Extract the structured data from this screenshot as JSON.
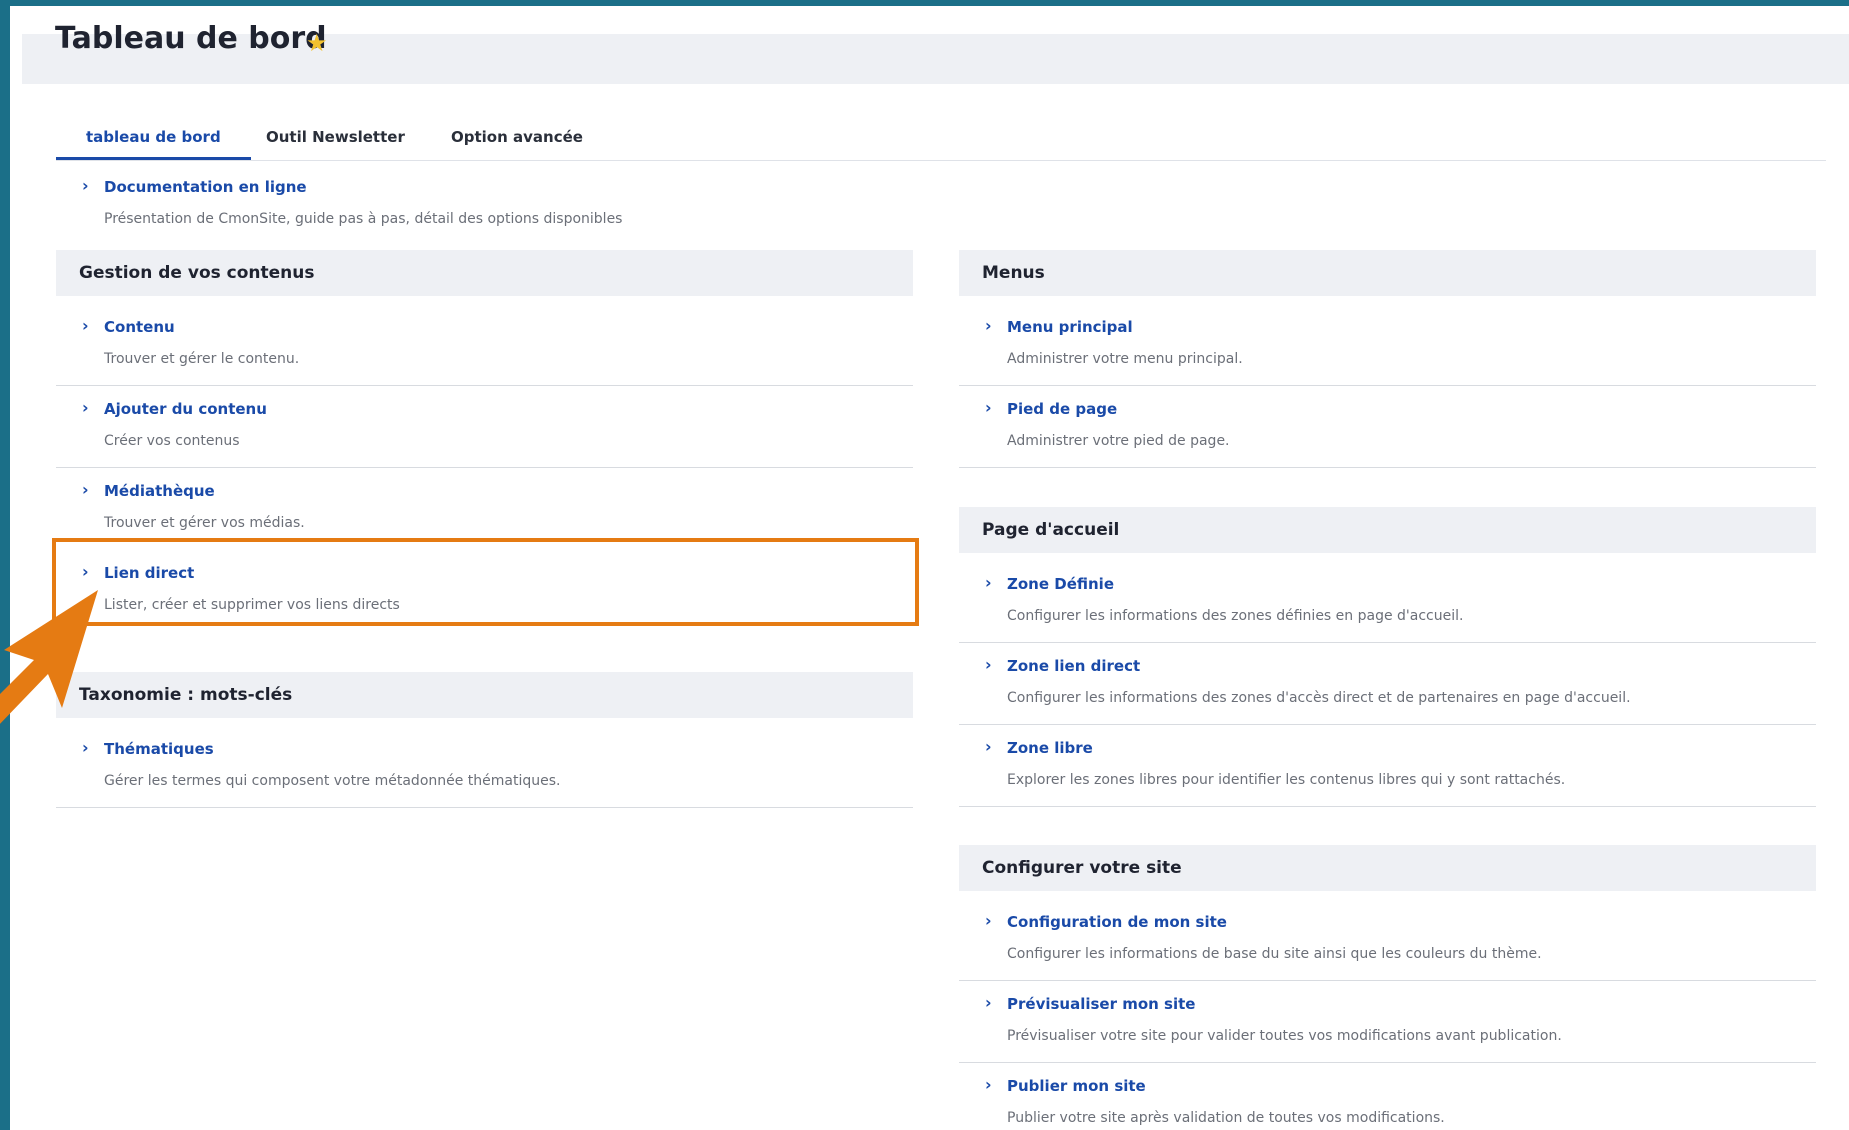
{
  "page": {
    "title": "Tableau de bord",
    "star_color": "#f2c230",
    "accent_color": "#1a4aa8",
    "highlight_color": "#e57b13"
  },
  "tabs": [
    {
      "label": "tableau de bord",
      "active": true
    },
    {
      "label": "Outil Newsletter",
      "active": false
    },
    {
      "label": "Option avancée",
      "active": false
    }
  ],
  "intro": {
    "link": "Documentation en ligne",
    "desc": "Présentation de CmonSite, guide pas à pas, détail des options disponibles"
  },
  "left": {
    "content_section": {
      "title": "Gestion de vos contenus",
      "items": [
        {
          "link": "Contenu",
          "desc": "Trouver et gérer le contenu."
        },
        {
          "link": "Ajouter du contenu",
          "desc": "Créer vos contenus"
        },
        {
          "link": "Médiathèque",
          "desc": "Trouver et gérer vos médias."
        },
        {
          "link": "Lien direct",
          "desc": "Lister, créer et supprimer vos liens directs"
        }
      ]
    },
    "taxonomy_section": {
      "title": "Taxonomie : mots-clés",
      "items": [
        {
          "link": "Thématiques",
          "desc": "Gérer les termes qui composent votre métadonnée thématiques."
        }
      ]
    }
  },
  "right": {
    "menus_section": {
      "title": "Menus",
      "items": [
        {
          "link": "Menu principal",
          "desc": "Administrer votre menu principal."
        },
        {
          "link": "Pied de page",
          "desc": "Administrer votre pied de page."
        }
      ]
    },
    "home_section": {
      "title": "Page d'accueil",
      "items": [
        {
          "link": "Zone Définie",
          "desc": "Configurer les informations des zones définies en page d'accueil."
        },
        {
          "link": "Zone lien direct",
          "desc": "Configurer les informations des zones d'accès direct et de partenaires en page d'accueil."
        },
        {
          "link": "Zone libre",
          "desc": "Explorer les zones libres pour identifier les contenus libres qui y sont rattachés."
        }
      ]
    },
    "config_section": {
      "title": "Configurer votre site",
      "items": [
        {
          "link": "Configuration de mon site",
          "desc": "Configurer les informations de base du site ainsi que les couleurs du thème."
        },
        {
          "link": "Prévisualiser mon site",
          "desc": "Prévisualiser votre site pour valider toutes vos modifications avant publication."
        },
        {
          "link": "Publier mon site",
          "desc": "Publier votre site après validation de toutes vos modifications."
        }
      ]
    }
  }
}
